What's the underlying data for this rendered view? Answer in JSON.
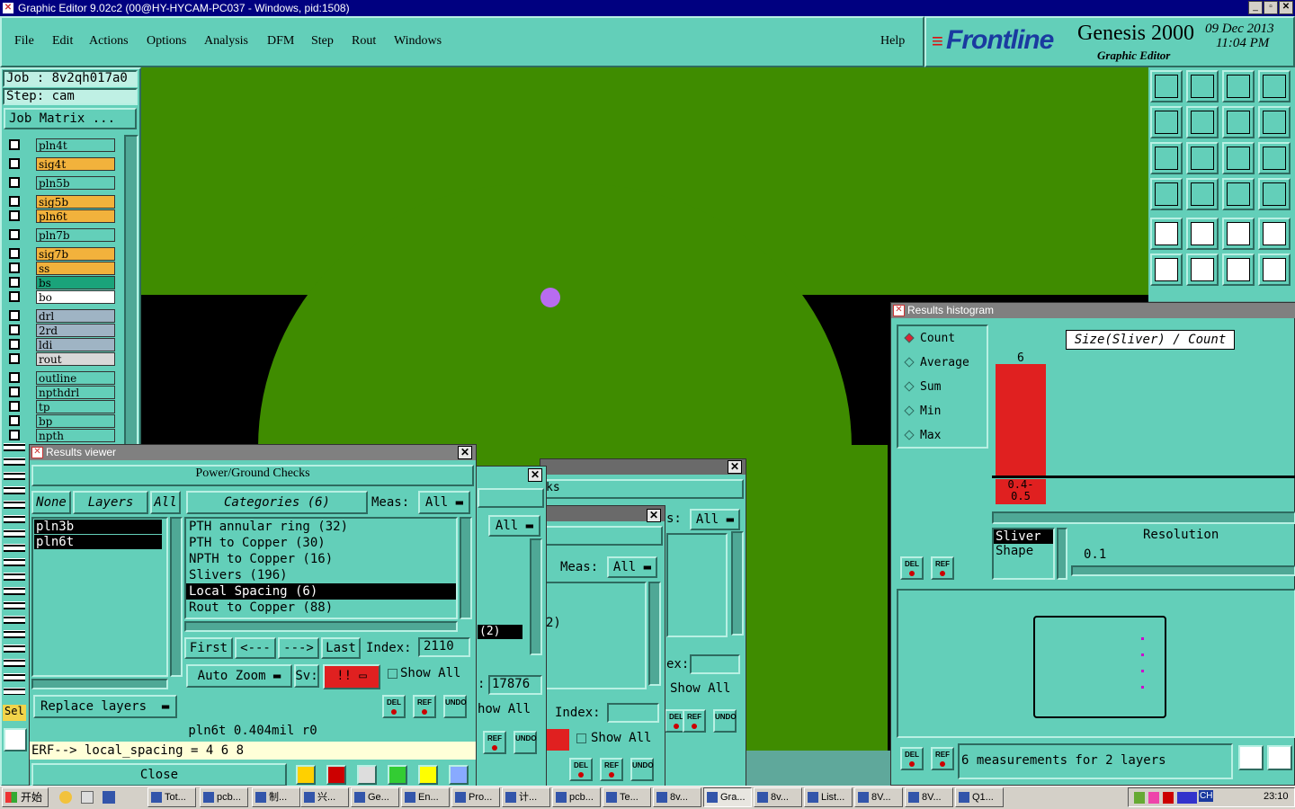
{
  "window": {
    "title": "Graphic Editor 9.02c2 (00@HY-HYCAM-PC037 - Windows, pid:1508)"
  },
  "menu": [
    "File",
    "Edit",
    "Actions",
    "Options",
    "Analysis",
    "DFM",
    "Step",
    "Rout",
    "Windows"
  ],
  "help_label": "Help",
  "brand": {
    "logo": "Frontline",
    "product": "Genesis 2000",
    "subtitle": "Graphic Editor",
    "date": "09 Dec 2013",
    "time": "11:04 PM"
  },
  "job": {
    "job_label": "Job : 8v2qh017a0",
    "step_label": "Step: cam",
    "matrix_button": "Job Matrix ..."
  },
  "layers": [
    {
      "name": "pln4t",
      "color": "#63cfb9"
    },
    {
      "name": "sig4t",
      "color": "#f2b23c"
    },
    {
      "name": "pln5b",
      "color": "#63cfb9"
    },
    {
      "name": "sig5b",
      "color": "#f2b23c"
    },
    {
      "name": "pln6t",
      "color": "#f2b23c"
    },
    {
      "name": "pln7b",
      "color": "#63cfb9"
    },
    {
      "name": "sig7b",
      "color": "#f2b23c"
    },
    {
      "name": "ss",
      "color": "#f2b23c"
    },
    {
      "name": "bs",
      "color": "#1aa37a"
    },
    {
      "name": "bo",
      "color": "#ffffff"
    },
    {
      "name": "drl",
      "color": "#9fb4c4"
    },
    {
      "name": "2rd",
      "color": "#9fb4c4"
    },
    {
      "name": "ldi",
      "color": "#9fb4c4"
    },
    {
      "name": "rout",
      "color": "#d8d8d8"
    },
    {
      "name": "outline",
      "color": "#63cfb9"
    },
    {
      "name": "npthdrl",
      "color": "#63cfb9"
    },
    {
      "name": "tp",
      "color": "#63cfb9"
    },
    {
      "name": "bp",
      "color": "#63cfb9"
    },
    {
      "name": "npth",
      "color": "#63cfb9"
    }
  ],
  "sel_label": "Sel",
  "results_viewer": {
    "title": "Results viewer",
    "heading": "Power/Ground Checks",
    "none_label": "None",
    "layers_label": "Layers",
    "all_label": "All",
    "layers": [
      "pln3b",
      "pln6t"
    ],
    "categories_label": "Categories (6)",
    "meas_label": "Meas:",
    "meas_value": "All",
    "categories": [
      "PTH annular ring (32)",
      "PTH to Copper (30)",
      "NPTH to Copper (16)",
      "Slivers (196)",
      "Local Spacing (6)",
      "Rout to Copper (88)"
    ],
    "selected_category": "Local Spacing (6)",
    "first_label": "First",
    "prev_label": "<---",
    "next_label": "--->",
    "last_label": "Last",
    "index_label": "Index:",
    "index_value": "2110",
    "auto_zoom_label": "Auto Zoom",
    "sv_label": "Sv:",
    "sv_value": "!!",
    "show_all_label": "Show All",
    "replace_layers_label": "Replace layers",
    "status_line": "pln6t 0.404mil  r0",
    "erf_line": "ERF--> local_spacing = 4 6 8",
    "close_label": "Close",
    "del_label": "DEL",
    "ref_label": "REF",
    "undo_label": "UNDO"
  },
  "behind_windows": {
    "heading_fragment": "ks",
    "all_label": "All",
    "meas_label": "Meas:",
    "count_fragment_a": "(2)",
    "count_fragment_b": "2)",
    "index_value": "17876",
    "show_all_label": "Show All",
    "show_all_fragment": "how All",
    "index_label": "Index:",
    "ex_label": "ex:",
    "s_label": "s:",
    "colon": ":"
  },
  "histogram": {
    "title": "Results histogram",
    "modes": [
      "Count",
      "Average",
      "Sum",
      "Min",
      "Max"
    ],
    "selected_mode": "Count",
    "chart_label": "Size(Sliver) / Count",
    "bar_value": "6",
    "bar_label": "0.4-\n0.5",
    "list": [
      "Sliver",
      "Shape"
    ],
    "resolution_label": "Resolution",
    "resolution_value": "0.1",
    "measurements": "6 measurements for 2 layers"
  },
  "taskbar": {
    "start": "开始",
    "items": [
      "Tot...",
      "pcb...",
      "制...",
      "兴...",
      "Ge...",
      "En...",
      "Pro...",
      "计...",
      "pcb...",
      "Te...",
      "8v...",
      "Gra...",
      "8v...",
      "List...",
      "8V...",
      "8V...",
      "Q1..."
    ],
    "ime": "CH",
    "clock": "23:10"
  },
  "colors": {
    "board": "#3f8c00",
    "canvas_bg": "#000000",
    "ui_teal": "#63cfb9",
    "selected_red": "#e02020"
  }
}
